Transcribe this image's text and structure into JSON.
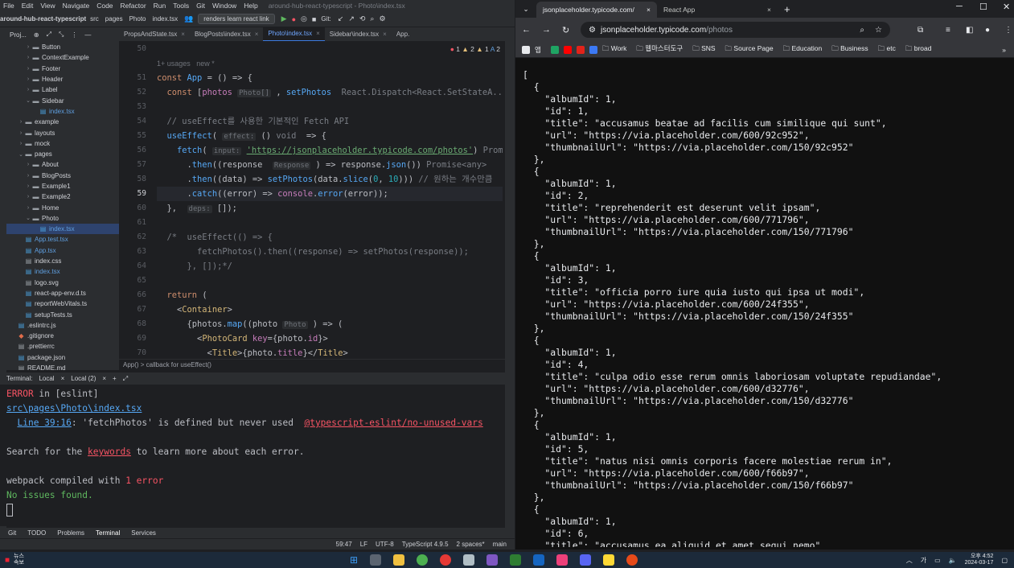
{
  "ide": {
    "menu": [
      "File",
      "Edit",
      "View",
      "Navigate",
      "Code",
      "Refactor",
      "Run",
      "Tools",
      "Git",
      "Window",
      "Help"
    ],
    "project_title": "around-hub-react-typescript - Photo\\index.tsx",
    "toolbar": {
      "project": "around-hub-react-typescript",
      "crumbs": [
        "src",
        "pages",
        "Photo",
        "index.tsx"
      ],
      "run_config": "renders learn react link",
      "git_label": "Git:"
    },
    "project_panel": {
      "label": "Proj...",
      "tree": [
        {
          "name": "Button",
          "type": "folder",
          "depth": 3
        },
        {
          "name": "ContextExample",
          "type": "folder",
          "depth": 3
        },
        {
          "name": "Footer",
          "type": "folder",
          "depth": 3
        },
        {
          "name": "Header",
          "type": "folder",
          "depth": 3
        },
        {
          "name": "Label",
          "type": "folder",
          "depth": 3
        },
        {
          "name": "Sidebar",
          "type": "folder",
          "depth": 3,
          "open": true
        },
        {
          "name": "index.tsx",
          "type": "file",
          "depth": 4
        },
        {
          "name": "example",
          "type": "folder",
          "depth": 2
        },
        {
          "name": "layouts",
          "type": "folder",
          "depth": 2
        },
        {
          "name": "mock",
          "type": "folder",
          "depth": 2
        },
        {
          "name": "pages",
          "type": "folder",
          "depth": 2,
          "open": true
        },
        {
          "name": "About",
          "type": "folder",
          "depth": 3
        },
        {
          "name": "BlogPosts",
          "type": "folder",
          "depth": 3
        },
        {
          "name": "Example1",
          "type": "folder",
          "depth": 3
        },
        {
          "name": "Example2",
          "type": "folder",
          "depth": 3
        },
        {
          "name": "Home",
          "type": "folder",
          "depth": 3
        },
        {
          "name": "Photo",
          "type": "folder",
          "depth": 3,
          "open": true
        },
        {
          "name": "index.tsx",
          "type": "file",
          "depth": 4,
          "selected": true
        },
        {
          "name": "App.test.tsx",
          "type": "file",
          "depth": 2
        },
        {
          "name": "App.tsx",
          "type": "file",
          "depth": 2
        },
        {
          "name": "index.css",
          "type": "file",
          "depth": 2
        },
        {
          "name": "index.tsx",
          "type": "file",
          "depth": 2
        },
        {
          "name": "logo.svg",
          "type": "file",
          "depth": 2
        },
        {
          "name": "react-app-env.d.ts",
          "type": "file",
          "depth": 2
        },
        {
          "name": "reportWebVitals.ts",
          "type": "file",
          "depth": 2
        },
        {
          "name": "setupTests.ts",
          "type": "file",
          "depth": 2
        },
        {
          "name": ".eslintrc.js",
          "type": "file",
          "depth": 1
        },
        {
          "name": ".gitignore",
          "type": "file",
          "depth": 1
        },
        {
          "name": ".prettierrc",
          "type": "file",
          "depth": 1
        },
        {
          "name": "package.json",
          "type": "file",
          "depth": 1
        },
        {
          "name": "README.md",
          "type": "file",
          "depth": 1
        }
      ]
    },
    "tabs": [
      {
        "label": "PropsAndState.tsx"
      },
      {
        "label": "BlogPosts\\index.tsx"
      },
      {
        "label": "Photo\\index.tsx",
        "active": true
      },
      {
        "label": "Sidebar\\index.tsx"
      },
      {
        "label": "App."
      }
    ],
    "inspections": {
      "errors": "1",
      "warnings": "2",
      "weak": "1",
      "typos": "2"
    },
    "line_numbers": [
      "50",
      "",
      "51",
      "52",
      "53",
      "54",
      "55",
      "56",
      "57",
      "58",
      "59",
      "60",
      "61",
      "62",
      "63",
      "64",
      "65",
      "66",
      "67",
      "68",
      "69",
      "70"
    ],
    "current_line": "59",
    "usage_hint": "1+ usages   new *",
    "breadcrumb": "App()  >  callback for useEffect()",
    "terminal": {
      "tabs": [
        "Terminal:",
        "Local",
        "Local (2)"
      ],
      "lines": {
        "l1a": "ERROR",
        "l1b": " in [eslint]",
        "l2": "src\\pages\\Photo\\index.tsx",
        "l3a": "Line 39:16",
        ": 'fetchPhotos' is defined but never used  ": "",
        "l3b": ": 'fetchPhotos' is defined but never used  ",
        "l3c": "@typescript-eslint/no-unused-vars",
        "l5a": "Search for the ",
        "l5b": "keywords",
        "l5c": " to learn more about each error.",
        "l7a": "webpack compiled with ",
        "l7b": "1 error",
        "l8": "No issues found."
      }
    },
    "bottom_tabs": [
      "Git",
      "TODO",
      "Problems",
      "Terminal",
      "Services"
    ],
    "status": {
      "pos": "59:47",
      "eol": "LF",
      "enc": "UTF-8",
      "lang": "TypeScript 4.9.5",
      "indent": "2 spaces*",
      "branch": "main"
    }
  },
  "browser": {
    "tabs": [
      {
        "label": "jsonplaceholder.typicode.com/",
        "active": true
      },
      {
        "label": "React App"
      }
    ],
    "url_host": "jsonplaceholder.typicode.com",
    "url_path": "/photos",
    "bookmarks": [
      "앱",
      "Work",
      "웹마스터도구",
      "SNS",
      "Source Page",
      "Education",
      "Business",
      "etc",
      "broad"
    ],
    "json_text": "[\n  {\n    \"albumId\": 1,\n    \"id\": 1,\n    \"title\": \"accusamus beatae ad facilis cum similique qui sunt\",\n    \"url\": \"https://via.placeholder.com/600/92c952\",\n    \"thumbnailUrl\": \"https://via.placeholder.com/150/92c952\"\n  },\n  {\n    \"albumId\": 1,\n    \"id\": 2,\n    \"title\": \"reprehenderit est deserunt velit ipsam\",\n    \"url\": \"https://via.placeholder.com/600/771796\",\n    \"thumbnailUrl\": \"https://via.placeholder.com/150/771796\"\n  },\n  {\n    \"albumId\": 1,\n    \"id\": 3,\n    \"title\": \"officia porro iure quia iusto qui ipsa ut modi\",\n    \"url\": \"https://via.placeholder.com/600/24f355\",\n    \"thumbnailUrl\": \"https://via.placeholder.com/150/24f355\"\n  },\n  {\n    \"albumId\": 1,\n    \"id\": 4,\n    \"title\": \"culpa odio esse rerum omnis laboriosam voluptate repudiandae\",\n    \"url\": \"https://via.placeholder.com/600/d32776\",\n    \"thumbnailUrl\": \"https://via.placeholder.com/150/d32776\"\n  },\n  {\n    \"albumId\": 1,\n    \"id\": 5,\n    \"title\": \"natus nisi omnis corporis facere molestiae rerum in\",\n    \"url\": \"https://via.placeholder.com/600/f66b97\",\n    \"thumbnailUrl\": \"https://via.placeholder.com/150/f66b97\"\n  },\n  {\n    \"albumId\": 1,\n    \"id\": 6,\n    \"title\": \"accusamus ea aliquid et amet sequi nemo\""
  },
  "taskbar": {
    "news_title": "뉴스",
    "news_sub": "속보",
    "time": "오후 4:52",
    "date": "2024-03-17",
    "ime": "가"
  },
  "colors": {
    "accent": "#3d7be0",
    "error": "#f75464",
    "ok": "#5fb85f",
    "link": "#56a8f5"
  }
}
